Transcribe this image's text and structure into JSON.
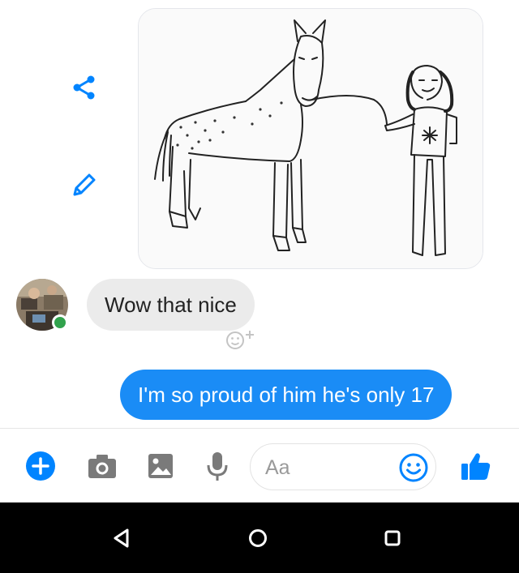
{
  "conversation": {
    "incoming_text": "Wow that nice",
    "outgoing_text": "I'm so proud of him he's only 17"
  },
  "composer": {
    "placeholder": "Aa"
  },
  "colors": {
    "accent": "#0084ff",
    "outgoing_bubble": "#1a8cf6",
    "incoming_bubble": "#ebebeb",
    "online": "#31a24c",
    "nav_bar": "#000000"
  },
  "icons": {
    "share": "share-icon",
    "edit": "pencil-icon",
    "add_reaction": "add-reaction-icon",
    "more": "plus-icon",
    "camera": "camera-icon",
    "gallery": "image-icon",
    "mic": "microphone-icon",
    "emoji": "smiley-icon",
    "like": "thumbs-up-icon",
    "back": "back-triangle-icon",
    "home": "home-circle-icon",
    "recent": "recent-apps-icon"
  }
}
